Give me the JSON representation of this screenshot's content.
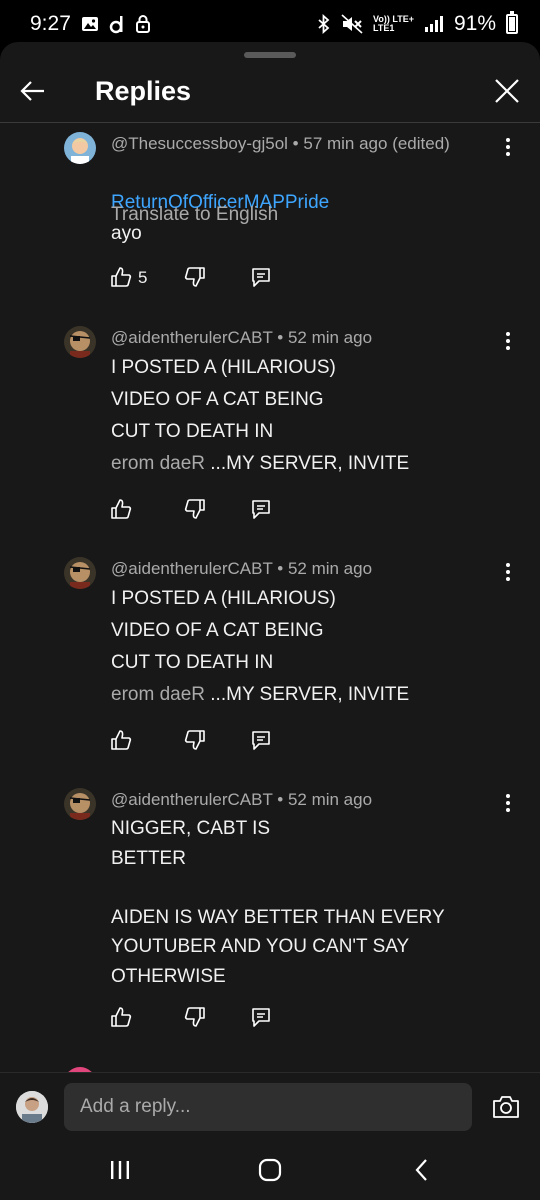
{
  "status_bar": {
    "time": "9:27",
    "left_icons": [
      "gallery-icon",
      "d-app-icon",
      "lock-icon"
    ],
    "network_top": "Vo)) LTE+",
    "network_bottom": "LTE1",
    "battery": "91%",
    "icons": [
      "bluetooth-icon",
      "mute-icon",
      "signal-icon",
      "battery-icon"
    ]
  },
  "header": {
    "title": "Replies",
    "back_icon": "back-arrow-icon",
    "close_icon": "close-icon"
  },
  "comments": [
    {
      "author": "@Thesuccessboy-gj5ol",
      "time": "57 min ago (edited)",
      "mention": "ReturnOfOfficerMAPPride",
      "text": "ayo",
      "translate": "Translate to English",
      "likes": "5"
    },
    {
      "author": "@aidentherulerCABT",
      "time": "52 min ago",
      "lines": [
        "I POSTED A (HILARIOUS)",
        "VIDEO OF A CAT BEING",
        "CUT TO DEATH IN"
      ],
      "last_line_reversed": "erom daeR",
      "last_line_text": " ...MY SERVER, INVITE"
    },
    {
      "author": "@aidentherulerCABT",
      "time": "52 min ago",
      "lines": [
        "I POSTED A (HILARIOUS)",
        "VIDEO OF A CAT BEING",
        "CUT TO DEATH IN"
      ],
      "last_line_reversed": "erom daeR",
      "last_line_text": " ...MY SERVER, INVITE"
    },
    {
      "author": "@aidentherulerCABT",
      "time": "52 min ago",
      "lines": [
        "NIGGER, CABT IS",
        "BETTER",
        "",
        "AIDEN IS WAY BETTER THAN EVERY",
        "YOUTUBER AND YOU CAN'T SAY",
        "OTHERWISE"
      ]
    }
  ],
  "meta_separator": " • ",
  "reply_bar": {
    "placeholder": "Add a reply...",
    "camera_icon": "camera-icon"
  },
  "nav_bar": {
    "icons": [
      "recent-apps-icon",
      "home-icon",
      "back-icon"
    ]
  },
  "colors": {
    "background": "#181818",
    "mention": "#3ea6ff",
    "secondary_text": "#aaaaaa"
  }
}
